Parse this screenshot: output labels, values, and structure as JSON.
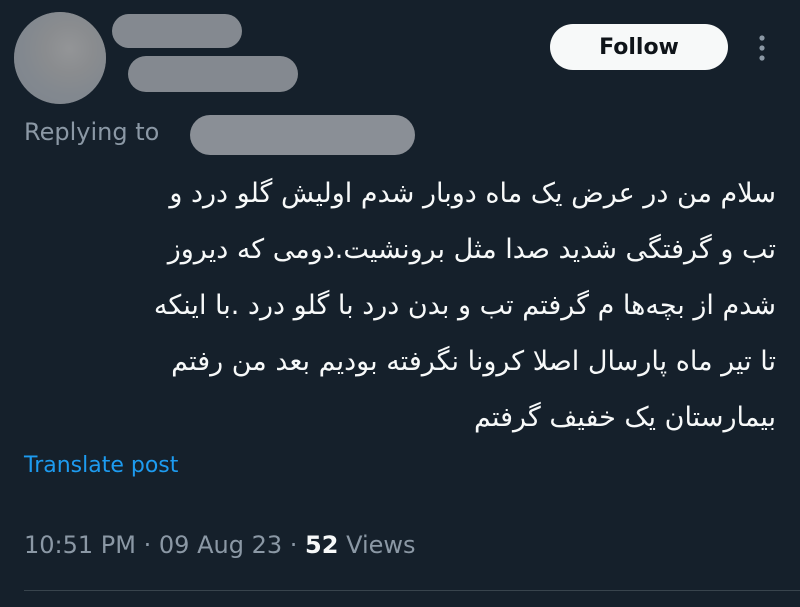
{
  "header": {
    "follow_label": "Follow",
    "more_icon": "more-vertical-icon"
  },
  "reply": {
    "prefix": "Replying to"
  },
  "tweet": {
    "lines": [
      "سلام من در عرض یک ماه دوبار شدم اولیش گلو درد و",
      "تب و گرفتگی شدید صدا مثل برونشیت.دومی که دیروز",
      "شدم از بچه‌ها م گرفتم تب و بدن درد با گلو درد .با اینکه",
      "تا تیر ماه پارسال اصلا کرونا نگرفته بودیم بعد من رفتم",
      "بیمارستان یک خفیف گرفتم"
    ],
    "translate_label": "Translate post"
  },
  "meta": {
    "time": "10:51 PM",
    "sep1": "·",
    "date": "09 Aug 23",
    "sep2": "·",
    "views_count": "52",
    "views_label": "Views"
  },
  "colors": {
    "background": "#15202b",
    "text_primary": "#f7f9f9",
    "text_secondary": "#8b98a5",
    "link": "#1d9bf0",
    "redaction": "#8a8f96"
  }
}
